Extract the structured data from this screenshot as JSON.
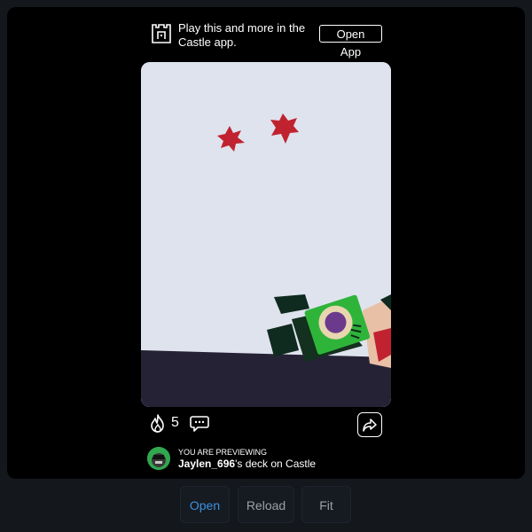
{
  "banner": {
    "text": "Play this and more in the Castle app.",
    "open_app_label": "Open App"
  },
  "card": {
    "background": "#dfe3ee",
    "floor": "#262235"
  },
  "actions": {
    "fire_icon": "fire-icon",
    "reaction_count": "5",
    "comment_icon": "comment-icon",
    "share_icon": "share-icon"
  },
  "preview": {
    "caption": "YOU ARE PREVIEWING",
    "username": "Jaylen_696",
    "suffix": "'s deck on Castle"
  },
  "buttons": {
    "open_label": "Open",
    "reload_label": "Reload",
    "fit_label": "Fit"
  },
  "colors": {
    "accent": "#3d8fe0",
    "panel": "#000000",
    "page": "#14171c"
  }
}
